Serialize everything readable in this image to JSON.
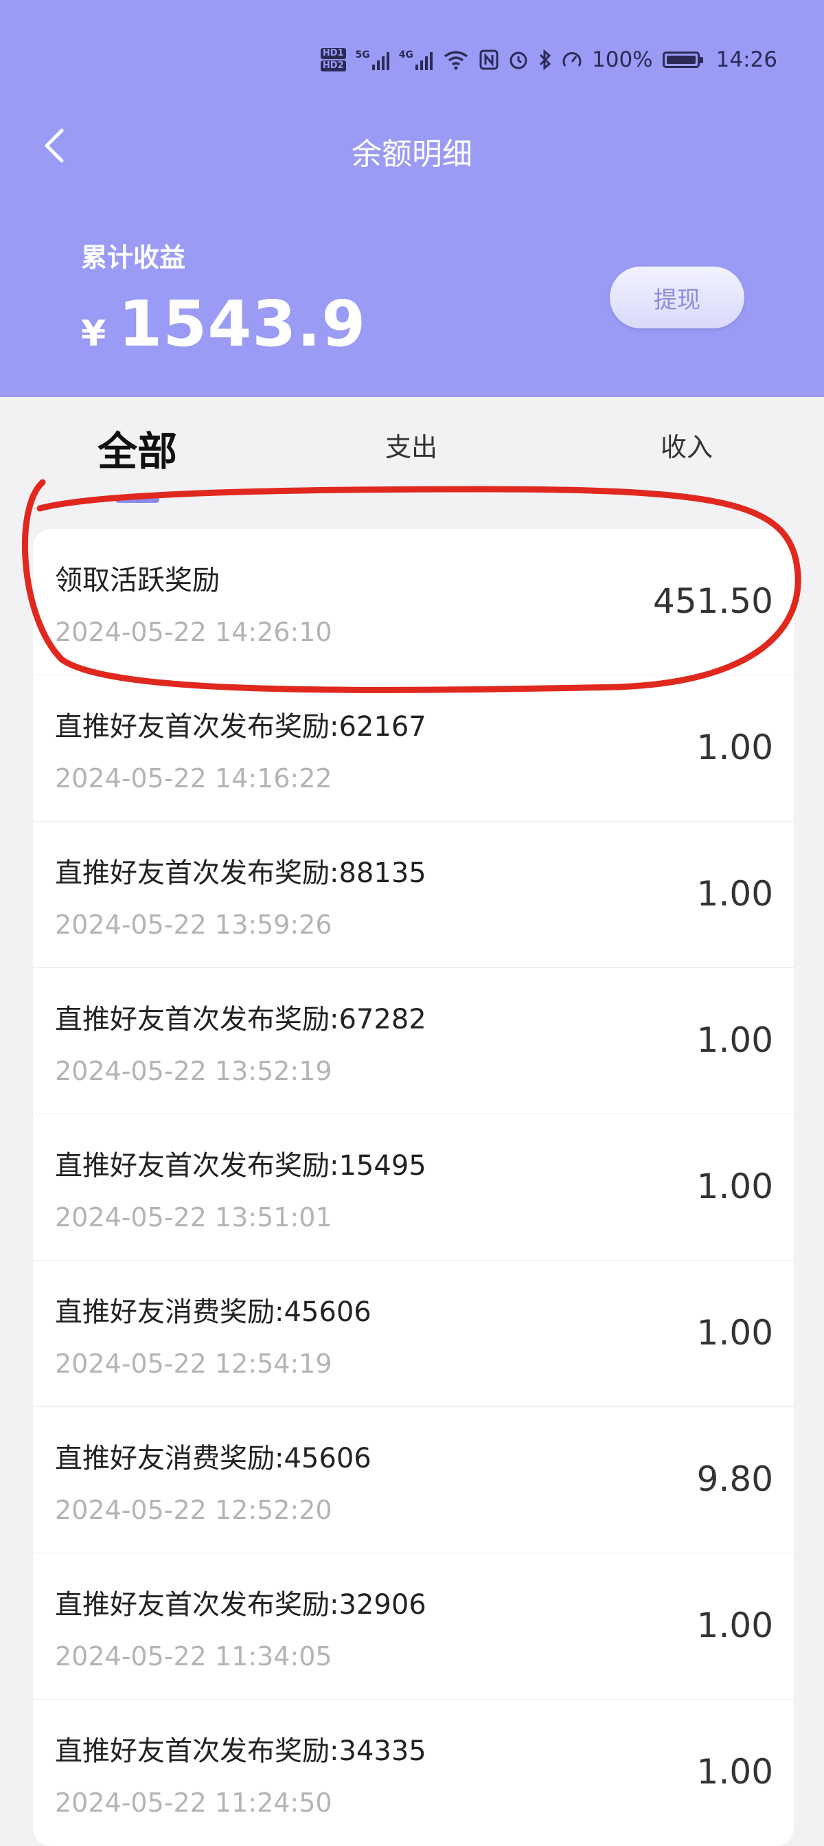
{
  "status_bar": {
    "hd1": "HD1",
    "hd2": "HD2",
    "net1": "5G",
    "net2": "4G",
    "battery_text": "100%",
    "time": "14:26",
    "icons": [
      "nfc-icon",
      "alarm-icon",
      "bluetooth-icon",
      "speed-icon",
      "battery-icon"
    ]
  },
  "header": {
    "back_icon": "chevron-left-icon",
    "title": "余额明细",
    "earnings_label": "累计收益",
    "currency": "¥",
    "earnings_amount": "1543.9",
    "withdraw_label": "提现",
    "colors": {
      "background": "#9a9bf5",
      "text": "#ffffff",
      "button_text": "#8b8cde"
    }
  },
  "tabs": [
    {
      "label": "全部",
      "active": true
    },
    {
      "label": "支出",
      "active": false
    },
    {
      "label": "收入",
      "active": false
    }
  ],
  "records": [
    {
      "title": "领取活跃奖励",
      "time": "2024-05-22 14:26:10",
      "amount": "451.50"
    },
    {
      "title": "直推好友首次发布奖励:62167",
      "time": "2024-05-22 14:16:22",
      "amount": "1.00"
    },
    {
      "title": "直推好友首次发布奖励:88135",
      "time": "2024-05-22 13:59:26",
      "amount": "1.00"
    },
    {
      "title": "直推好友首次发布奖励:67282",
      "time": "2024-05-22 13:52:19",
      "amount": "1.00"
    },
    {
      "title": "直推好友首次发布奖励:15495",
      "time": "2024-05-22 13:51:01",
      "amount": "1.00"
    },
    {
      "title": "直推好友消费奖励:45606",
      "time": "2024-05-22 12:54:19",
      "amount": "1.00"
    },
    {
      "title": "直推好友消费奖励:45606",
      "time": "2024-05-22 12:52:20",
      "amount": "9.80"
    },
    {
      "title": "直推好友首次发布奖励:32906",
      "time": "2024-05-22 11:34:05",
      "amount": "1.00"
    },
    {
      "title": "直推好友首次发布奖励:34335",
      "time": "2024-05-22 11:24:50",
      "amount": "1.00"
    }
  ],
  "annotation": {
    "color": "#e0281e"
  }
}
